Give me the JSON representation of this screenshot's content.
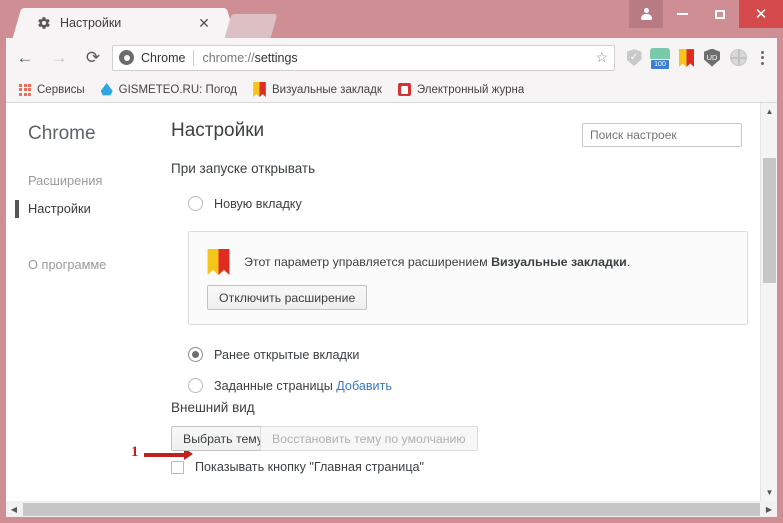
{
  "window": {
    "controls": {
      "profile": "profile-icon",
      "minimize": "–",
      "maximize": "□",
      "close": "✕"
    }
  },
  "tabs": [
    {
      "title": "Настройки",
      "favicon": "gear-icon",
      "close": "✕",
      "active": true
    }
  ],
  "toolbar": {
    "back": "←",
    "forward": "→",
    "reload": "⟳",
    "omnibox": {
      "brand": "Chrome",
      "url": "chrome://",
      "url_bold": "settings",
      "star": "☆"
    },
    "extensions": [
      {
        "name": "shield-check-icon",
        "badge": ""
      },
      {
        "name": "green-counter-icon",
        "badge": "100"
      },
      {
        "name": "bookmark-flag-icon",
        "badge": ""
      },
      {
        "name": "ud-shield-icon",
        "badge": "UD"
      },
      {
        "name": "globe-icon",
        "badge": ""
      }
    ],
    "menu": "kebab-menu-icon"
  },
  "bookmarks": [
    {
      "label": "Сервисы",
      "icon": "apps-grid-icon"
    },
    {
      "label": "GISMETEO.RU: Погод",
      "icon": "water-drop-icon"
    },
    {
      "label": "Визуальные закладк",
      "icon": "bookmark-flag-icon"
    },
    {
      "label": "Электронный журна",
      "icon": "red-document-icon"
    }
  ],
  "sidebar": {
    "title": "Chrome",
    "items": [
      {
        "label": "Расширения",
        "active": false
      },
      {
        "label": "Настройки",
        "active": true
      },
      {
        "label": "О программе",
        "active": false
      }
    ]
  },
  "main": {
    "title": "Настройки",
    "search": {
      "placeholder": "Поиск настроек",
      "value": ""
    },
    "startup": {
      "heading": "При запуске открывать",
      "options": [
        {
          "label": "Новую вкладку",
          "selected": false
        },
        {
          "label": "Ранее открытые вкладки",
          "selected": true
        },
        {
          "label": "Заданные страницы",
          "link": "Добавить",
          "selected": false
        }
      ],
      "notice": {
        "text_before": "Этот параметр управляется расширением ",
        "extension_name": "Визуальные закладки",
        "text_after": ".",
        "button": "Отключить расширение",
        "icon": "bookmark-flag-icon"
      }
    },
    "appearance": {
      "heading": "Внешний вид",
      "pick_theme": "Выбрать тему",
      "reset_theme": "Восстановить тему по умолчанию",
      "show_home_button": "Показывать кнопку \"Главная страница\""
    }
  },
  "annotation": {
    "number": "1"
  },
  "colors": {
    "frame": "#cf8d94",
    "close_button": "#d44a4a",
    "annotation_red": "#c0201e",
    "link_blue": "#3a78c2",
    "accent_flag_yellow": "#f5c518",
    "accent_flag_red": "#e02b20"
  }
}
